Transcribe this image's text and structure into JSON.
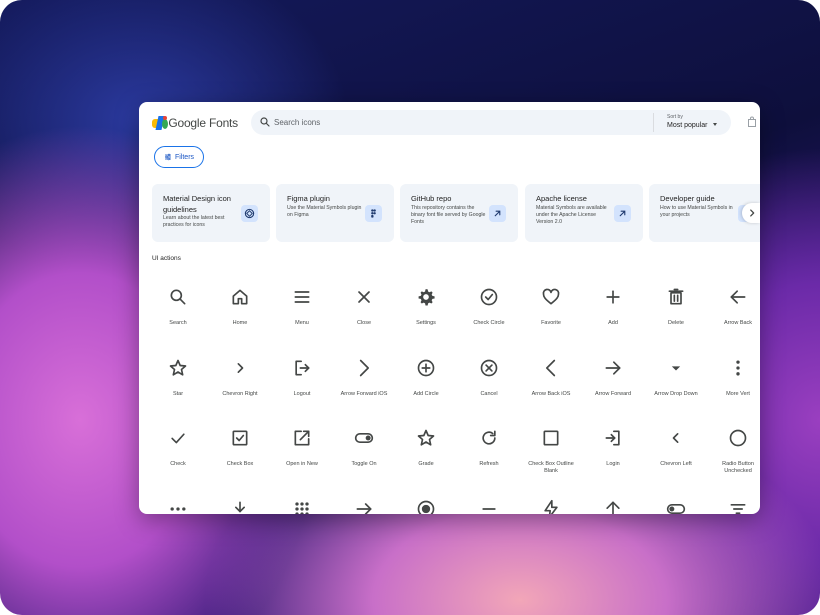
{
  "app": {
    "logo_text": "Google Fonts"
  },
  "search": {
    "placeholder": "Search icons"
  },
  "sort": {
    "label": "Sort by",
    "value": "Most popular"
  },
  "filters": {
    "label": "Filters"
  },
  "cards": [
    {
      "title": "Material Design icon guidelines",
      "description": "Learn about the latest best practices for icons",
      "icon": "material-logo-icon"
    },
    {
      "title": "Figma plugin",
      "description": "Use the Material Symbols plugin on Figma",
      "icon": "figma-icon"
    },
    {
      "title": "GitHub repo",
      "description": "This repository contains the binary font file served by Google Fonts",
      "icon": "arrow-outward-icon"
    },
    {
      "title": "Apache license",
      "description": "Material Symbols are available under the Apache License Version 2.0",
      "icon": "arrow-outward-icon"
    },
    {
      "title": "Developer guide",
      "description": "How to use Material Symbols in your projects",
      "icon": "arrow-outward-icon"
    }
  ],
  "section_title": "UI actions",
  "icons": [
    {
      "label": "Search",
      "icon": "search"
    },
    {
      "label": "Home",
      "icon": "home"
    },
    {
      "label": "Menu",
      "icon": "menu"
    },
    {
      "label": "Close",
      "icon": "close"
    },
    {
      "label": "Settings",
      "icon": "settings"
    },
    {
      "label": "Check Circle",
      "icon": "check-circle"
    },
    {
      "label": "Favorite",
      "icon": "favorite"
    },
    {
      "label": "Add",
      "icon": "add"
    },
    {
      "label": "Delete",
      "icon": "delete"
    },
    {
      "label": "Arrow Back",
      "icon": "arrow-back"
    },
    {
      "label": "Star",
      "icon": "star"
    },
    {
      "label": "Chevron Right",
      "icon": "chevron-right"
    },
    {
      "label": "Logout",
      "icon": "logout"
    },
    {
      "label": "Arrow Forward iOS",
      "icon": "arrow-forward-ios"
    },
    {
      "label": "Add Circle",
      "icon": "add-circle"
    },
    {
      "label": "Cancel",
      "icon": "cancel"
    },
    {
      "label": "Arrow Back iOS",
      "icon": "arrow-back-ios"
    },
    {
      "label": "Arrow Forward",
      "icon": "arrow-forward"
    },
    {
      "label": "Arrow Drop Down",
      "icon": "arrow-drop-down"
    },
    {
      "label": "More Vert",
      "icon": "more-vert"
    },
    {
      "label": "Check",
      "icon": "check"
    },
    {
      "label": "Check Box",
      "icon": "check-box"
    },
    {
      "label": "Open in New",
      "icon": "open-in-new"
    },
    {
      "label": "Toggle On",
      "icon": "toggle-on"
    },
    {
      "label": "Grade",
      "icon": "grade"
    },
    {
      "label": "Refresh",
      "icon": "refresh"
    },
    {
      "label": "Check Box Outline Blank",
      "icon": "check-box-outline-blank"
    },
    {
      "label": "Login",
      "icon": "login"
    },
    {
      "label": "Chevron Left",
      "icon": "chevron-left"
    },
    {
      "label": "Radio Button Unchecked",
      "icon": "radio-button-unchecked"
    },
    {
      "label": "",
      "icon": "more-horiz"
    },
    {
      "label": "",
      "icon": "download"
    },
    {
      "label": "",
      "icon": "apps"
    },
    {
      "label": "",
      "icon": "east"
    },
    {
      "label": "",
      "icon": "radio-button-checked"
    },
    {
      "label": "",
      "icon": "remove"
    },
    {
      "label": "",
      "icon": "bolt"
    },
    {
      "label": "",
      "icon": "arrow-upward"
    },
    {
      "label": "",
      "icon": "toggle-off"
    },
    {
      "label": "",
      "icon": "filter-list"
    }
  ]
}
